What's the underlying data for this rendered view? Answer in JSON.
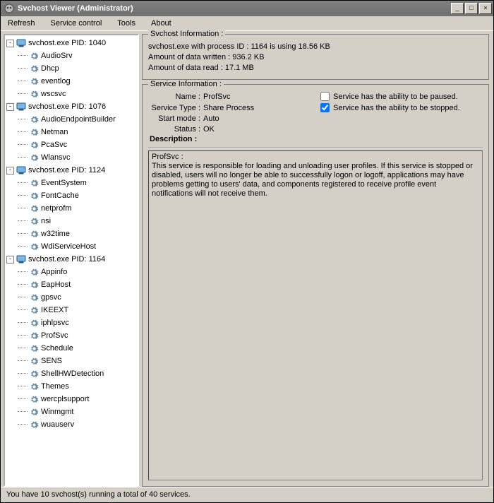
{
  "window": {
    "title": "Svchost Viewer (Administrator)"
  },
  "menu": {
    "refresh": "Refresh",
    "service_control": "Service control",
    "tools": "Tools",
    "about": "About"
  },
  "tree": {
    "groups": [
      {
        "label": "svchost.exe PID: 1040",
        "children": [
          "AudioSrv",
          "Dhcp",
          "eventlog",
          "wscsvc"
        ]
      },
      {
        "label": "svchost.exe PID: 1076",
        "children": [
          "AudioEndpointBuilder",
          "Netman",
          "PcaSvc",
          "Wlansvc"
        ]
      },
      {
        "label": "svchost.exe PID: 1124",
        "children": [
          "EventSystem",
          "FontCache",
          "netprofm",
          "nsi",
          "w32time",
          "WdiServiceHost"
        ]
      },
      {
        "label": "svchost.exe PID: 1164",
        "children": [
          "Appinfo",
          "EapHost",
          "gpsvc",
          "IKEEXT",
          "iphlpsvc",
          "ProfSvc",
          "Schedule",
          "SENS",
          "ShellHWDetection",
          "Themes",
          "wercplsupport",
          "Winmgmt",
          "wuauserv"
        ]
      }
    ]
  },
  "svchost_info": {
    "legend": "Svchost Information :",
    "line1": "svchost.exe with process ID : 1164 is using 18.56 KB",
    "line2": "Amount of data written : 936.2 KB",
    "line3": "Amount of data read : 17.1 MB"
  },
  "service_info": {
    "legend": "Service Information :",
    "name_label": "Name :",
    "name_value": "ProfSvc",
    "type_label": "Service Type :",
    "type_value": "Share Process",
    "start_label": "Start mode :",
    "start_value": "Auto",
    "status_label": "Status :",
    "status_value": "OK",
    "chk_paused_label": "Service has the ability to be paused.",
    "chk_paused_checked": false,
    "chk_stopped_label": "Service has the ability to be stopped.",
    "chk_stopped_checked": true
  },
  "description": {
    "head": "Description  :",
    "title": "ProfSvc :",
    "body": "This service is responsible for loading and unloading user profiles. If this service is stopped or disabled, users will no longer be able to successfully logon or logoff, applications may have problems getting to users' data, and components registered to receive profile event notifications will not receive them."
  },
  "statusbar": {
    "text": "You have 10 svchost(s) running a total of 40 services."
  }
}
